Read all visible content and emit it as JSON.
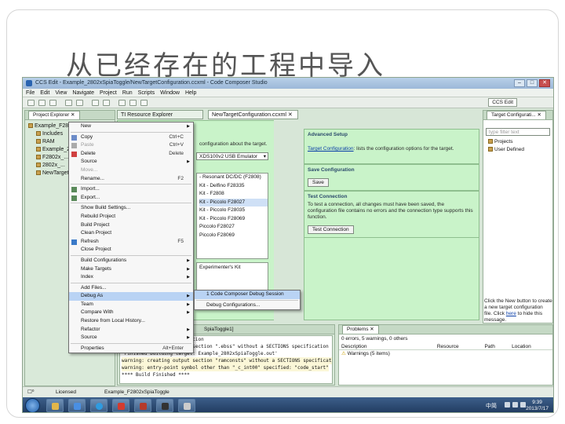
{
  "slide": {
    "title": "从已经存在的工程中导入"
  },
  "window": {
    "title": "CCS Edit - Example_2802xSpiaToggle/NewTargetConfiguration.ccxml - Code Composer Studio",
    "buttons": {
      "minimize": "–",
      "maximize": "□",
      "close": "✕"
    }
  },
  "menubar": [
    "File",
    "Edit",
    "View",
    "Navigate",
    "Project",
    "Run",
    "Scripts",
    "Window",
    "Help"
  ],
  "toolbar": {
    "perspective": "CCS Edit"
  },
  "project_explorer": {
    "tabs": [
      "Project Explorer ✕"
    ],
    "items": [
      "Example_F2802xSpiaToggle [Act...",
      "Includes",
      "RAM",
      "Example_2802xSpiaToggle.c",
      "F2802x_...",
      "2802x_...",
      "NewTarget..."
    ]
  },
  "editor_tabs": [
    "TI Resource Explorer",
    "NewTargetConfiguration.ccxml ✕"
  ],
  "config": {
    "basic_line": "configuration about the target.",
    "connection_value": "XDS100v2 USB Emulator",
    "board_list": [
      "- Resonant DC/DC (F2808)",
      "Kit - Delfino F28335",
      "Kit - F2808",
      "Kit - Piccolo F28027",
      "Kit - Piccolo F28035",
      "Kit - Piccolo F28069",
      "Piccolo F28027",
      "Piccolo F28069"
    ],
    "experimenters_kit": "Experimenter's Kit",
    "advanced_setup": {
      "heading": "Advanced Setup",
      "link": "Target Configuration",
      "text": ": lists the configuration options for the target."
    },
    "save_configuration": {
      "heading": "Save Configuration",
      "button": "Save"
    },
    "test_connection": {
      "heading": "Test Connection",
      "lines": [
        "To test a connection, all changes must have been saved, the",
        "configuration file contains no errors and the connection type supports this",
        "function."
      ],
      "button": "Test Connection"
    }
  },
  "target_configurations": {
    "tab": "Target Configurati... ✕",
    "filter_placeholder": "type filter text",
    "items": [
      "Projects",
      "User Defined"
    ],
    "hint_lines": [
      "Click the New button to create",
      "a new target configuration",
      "file. Click ",
      "here",
      " to hide this",
      "message."
    ]
  },
  "console": {
    "header": "SpiaToggle1]",
    "lines": [
      "with a SECTIONS specification",
      "warning: creating output section \".ebss\" without a SECTIONS specification",
      "'Finished building target: Example_2802xSpiaToggle.out'",
      "warning: creating output section \"ramconsts\" without a SECTIONS specification",
      "",
      "warning: entry-point symbol other than \"_c_int00\" specified: \"code_start\"",
      "",
      "**** Build Finished ****"
    ]
  },
  "problems": {
    "tab": "Problems ✕",
    "summary": "0 errors, 5 warnings, 0 others",
    "columns": [
      "Description",
      "Resource",
      "Path",
      "Location"
    ],
    "rows": [
      [
        "Warnings (5 items)",
        "",
        "",
        ""
      ]
    ]
  },
  "context_menu": [
    {
      "label": "New",
      "arrow": true
    },
    {
      "sep": true
    },
    {
      "label": "Copy",
      "shortcut": "Ctrl+C",
      "icon": "copy-icon"
    },
    {
      "label": "Paste",
      "shortcut": "Ctrl+V",
      "icon": "paste-icon",
      "disabled": true
    },
    {
      "label": "Delete",
      "shortcut": "Delete",
      "icon": "delete-icon"
    },
    {
      "label": "Source",
      "arrow": true
    },
    {
      "label": "Move...",
      "disabled": true
    },
    {
      "label": "Rename...",
      "shortcut": "F2"
    },
    {
      "sep": true
    },
    {
      "label": "Import...",
      "icon": "import-icon"
    },
    {
      "label": "Export...",
      "icon": "export-icon"
    },
    {
      "sep": true
    },
    {
      "label": "Show Build Settings..."
    },
    {
      "label": "Rebuild Project"
    },
    {
      "label": "Build Project"
    },
    {
      "label": "Clean Project"
    },
    {
      "label": "Refresh",
      "shortcut": "F5",
      "icon": "refresh-icon"
    },
    {
      "label": "Close Project"
    },
    {
      "sep": true
    },
    {
      "label": "Build Configurations",
      "arrow": true
    },
    {
      "label": "Make Targets",
      "arrow": true
    },
    {
      "label": "Index",
      "arrow": true
    },
    {
      "sep": true
    },
    {
      "label": "Add Files..."
    },
    {
      "label": "Debug As",
      "arrow": true,
      "highlight": true
    },
    {
      "label": "Team",
      "arrow": true
    },
    {
      "label": "Compare With",
      "arrow": true
    },
    {
      "label": "Restore from Local History..."
    },
    {
      "label": "Refactor",
      "arrow": true
    },
    {
      "label": "Source",
      "arrow": true
    },
    {
      "sep": true
    },
    {
      "label": "Properties",
      "shortcut": "Alt+Enter"
    }
  ],
  "submenu": [
    {
      "label": "1 Code Composer Debug Session",
      "highlight": true
    },
    {
      "sep": true
    },
    {
      "label": "Debug Configurations..."
    }
  ],
  "statusbar": {
    "left": "☐⁰",
    "licensed": "Licensed",
    "project": "Example_F2802xSpiaToggle"
  },
  "taskbar": {
    "ime": "中简",
    "time": "9:39",
    "date": "2013/7/17"
  },
  "colors": {
    "panel_green": "#c9f3c9",
    "section_heading": "#2b4a6b",
    "menu_highlight": "#b9d3f4"
  }
}
